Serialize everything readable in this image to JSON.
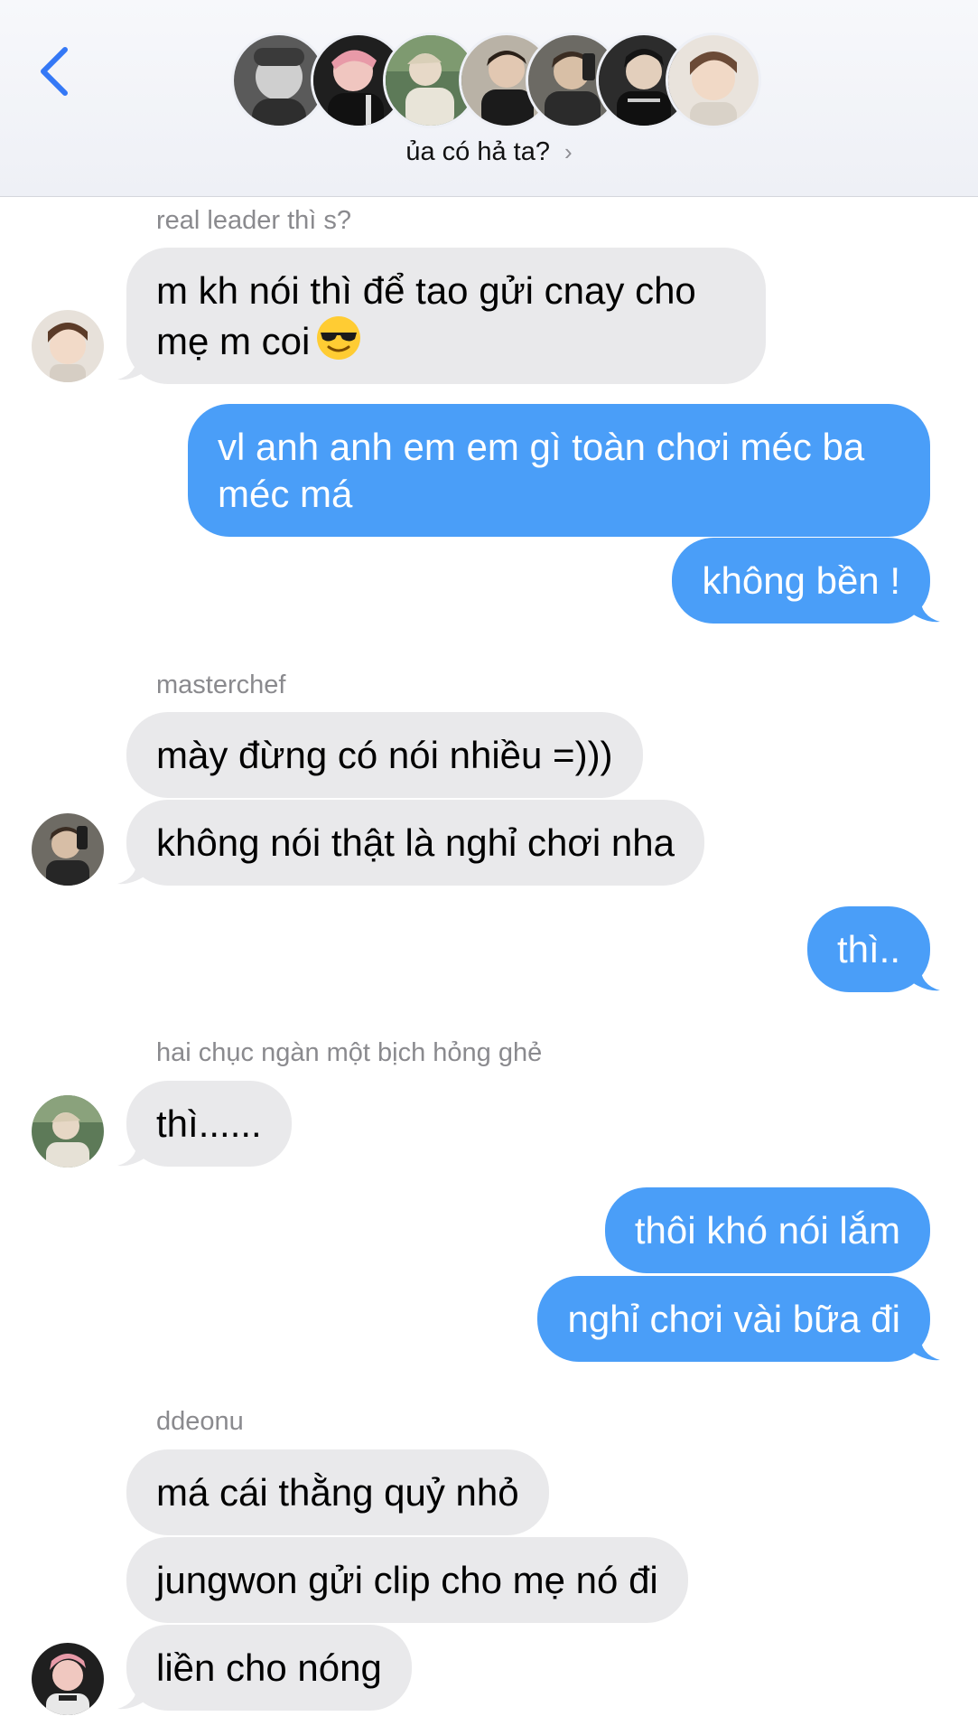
{
  "header": {
    "back_icon": "chevron-left-icon",
    "group_name": "ủa có hả ta?",
    "chevron": "›",
    "accent": "#3478f6",
    "member_avatar_icons": [
      "member-avatar-1",
      "member-avatar-2",
      "member-avatar-3",
      "member-avatar-4",
      "member-avatar-5",
      "member-avatar-6",
      "member-avatar-7"
    ]
  },
  "messages": {
    "sender_1": "real leader thì s?",
    "m1_line": "m kh nói thì để tao gửi cnay cho mẹ m coi",
    "m1_emoji": "smiling-face-with-sunglasses-icon",
    "m2": "vl anh anh em em gì toàn chơi méc ba méc má",
    "m3": "không bền !",
    "sender_2": "masterchef",
    "m4": "mày đừng có nói nhiều =)))",
    "m5": "không nói thật là nghỉ chơi nha",
    "m6": "thì..",
    "sender_3": "hai chục ngàn một bịch hỏng ghẻ",
    "m7": "thì......",
    "m8": "thôi khó nói lắm",
    "m9": "nghỉ chơi vài bữa đi",
    "sender_4": "ddeonu",
    "m10": "má cái thằng quỷ nhỏ",
    "m11": "jungwon gửi clip cho mẹ nó đi",
    "m12": "liền cho nóng"
  },
  "colors": {
    "sent_bubble": "#4a9ef8",
    "received_bubble": "#e9e9eb",
    "sender_label": "#8a8a8e"
  }
}
